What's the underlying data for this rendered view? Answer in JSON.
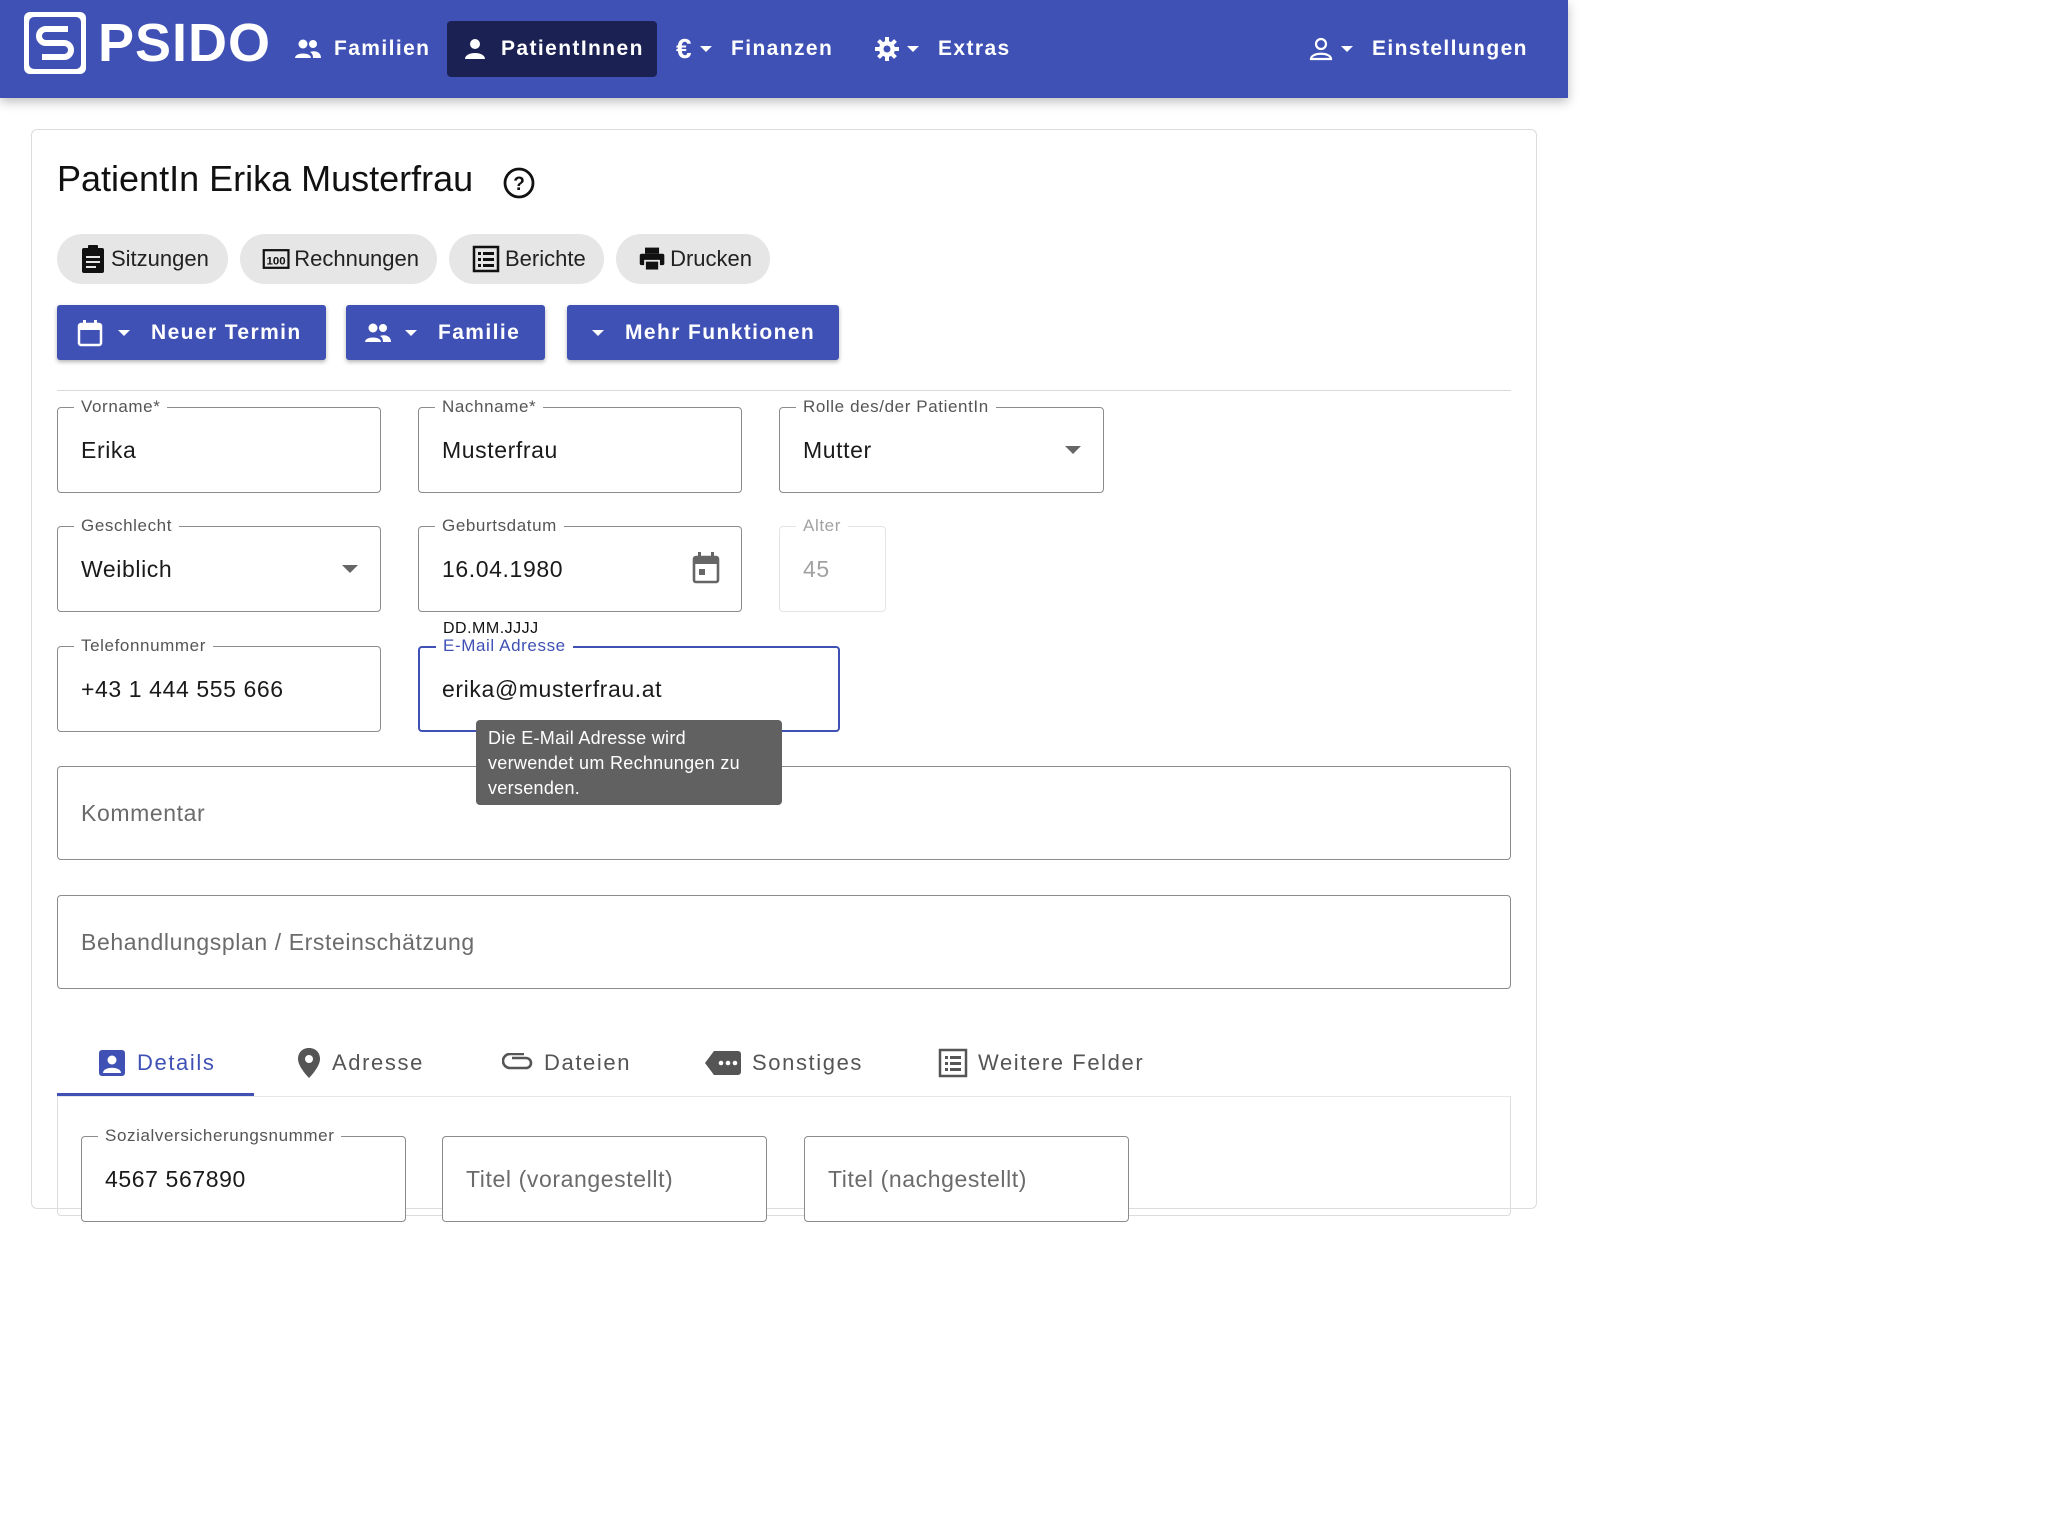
{
  "app": {
    "brand": "PSIDO",
    "colors": {
      "primary": "#3f51b5",
      "active_nav": "#1b2152",
      "tooltip": "#616161"
    }
  },
  "nav": {
    "familien": {
      "label": "Familien",
      "icon": "people-icon"
    },
    "patienten": {
      "label": "PatientInnen",
      "icon": "person-icon"
    },
    "finanzen": {
      "label": "Finanzen",
      "icon": "euro-icon"
    },
    "extras": {
      "label": "Extras",
      "icon": "gear-icon"
    },
    "einstellungen": {
      "label": "Einstellungen",
      "icon": "account-icon"
    }
  },
  "page": {
    "title": "PatientIn Erika Musterfrau"
  },
  "chips": {
    "sitzungen": "Sitzungen",
    "rechnungen": "Rechnungen",
    "berichte": "Berichte",
    "drucken": "Drucken"
  },
  "actions": {
    "neuer_termin": "Neuer Termin",
    "familie": "Familie",
    "mehr_funktionen": "Mehr Funktionen"
  },
  "form": {
    "vorname": {
      "label": "Vorname*",
      "value": "Erika"
    },
    "nachname": {
      "label": "Nachname*",
      "value": "Musterfrau"
    },
    "rolle": {
      "label": "Rolle des/der PatientIn",
      "value": "Mutter"
    },
    "geschlecht": {
      "label": "Geschlecht",
      "value": "Weiblich"
    },
    "geburtsdatum": {
      "label": "Geburtsdatum",
      "value": "16.04.1980",
      "hint": "DD.MM.JJJJ"
    },
    "alter": {
      "label": "Alter",
      "value": "45"
    },
    "telefon": {
      "label": "Telefonnummer",
      "value": "+43 1 444 555 666"
    },
    "email": {
      "label": "E-Mail Adresse",
      "value": "erika@musterfrau.at",
      "tooltip": "Die E-Mail Adresse wird verwendet um Rechnungen zu versenden."
    },
    "kommentar": {
      "placeholder": "Kommentar"
    },
    "behandlungsplan": {
      "placeholder": "Behandlungsplan / Ersteinschätzung"
    }
  },
  "tabs": {
    "details": "Details",
    "adresse": "Adresse",
    "dateien": "Dateien",
    "sonstiges": "Sonstiges",
    "weitere": "Weitere Felder"
  },
  "details": {
    "svnr": {
      "label": "Sozialversicherungsnummer",
      "value": "4567 567890"
    },
    "titel_vor": {
      "placeholder": "Titel (vorangestellt)"
    },
    "titel_nach": {
      "placeholder": "Titel (nachgestellt)"
    }
  }
}
